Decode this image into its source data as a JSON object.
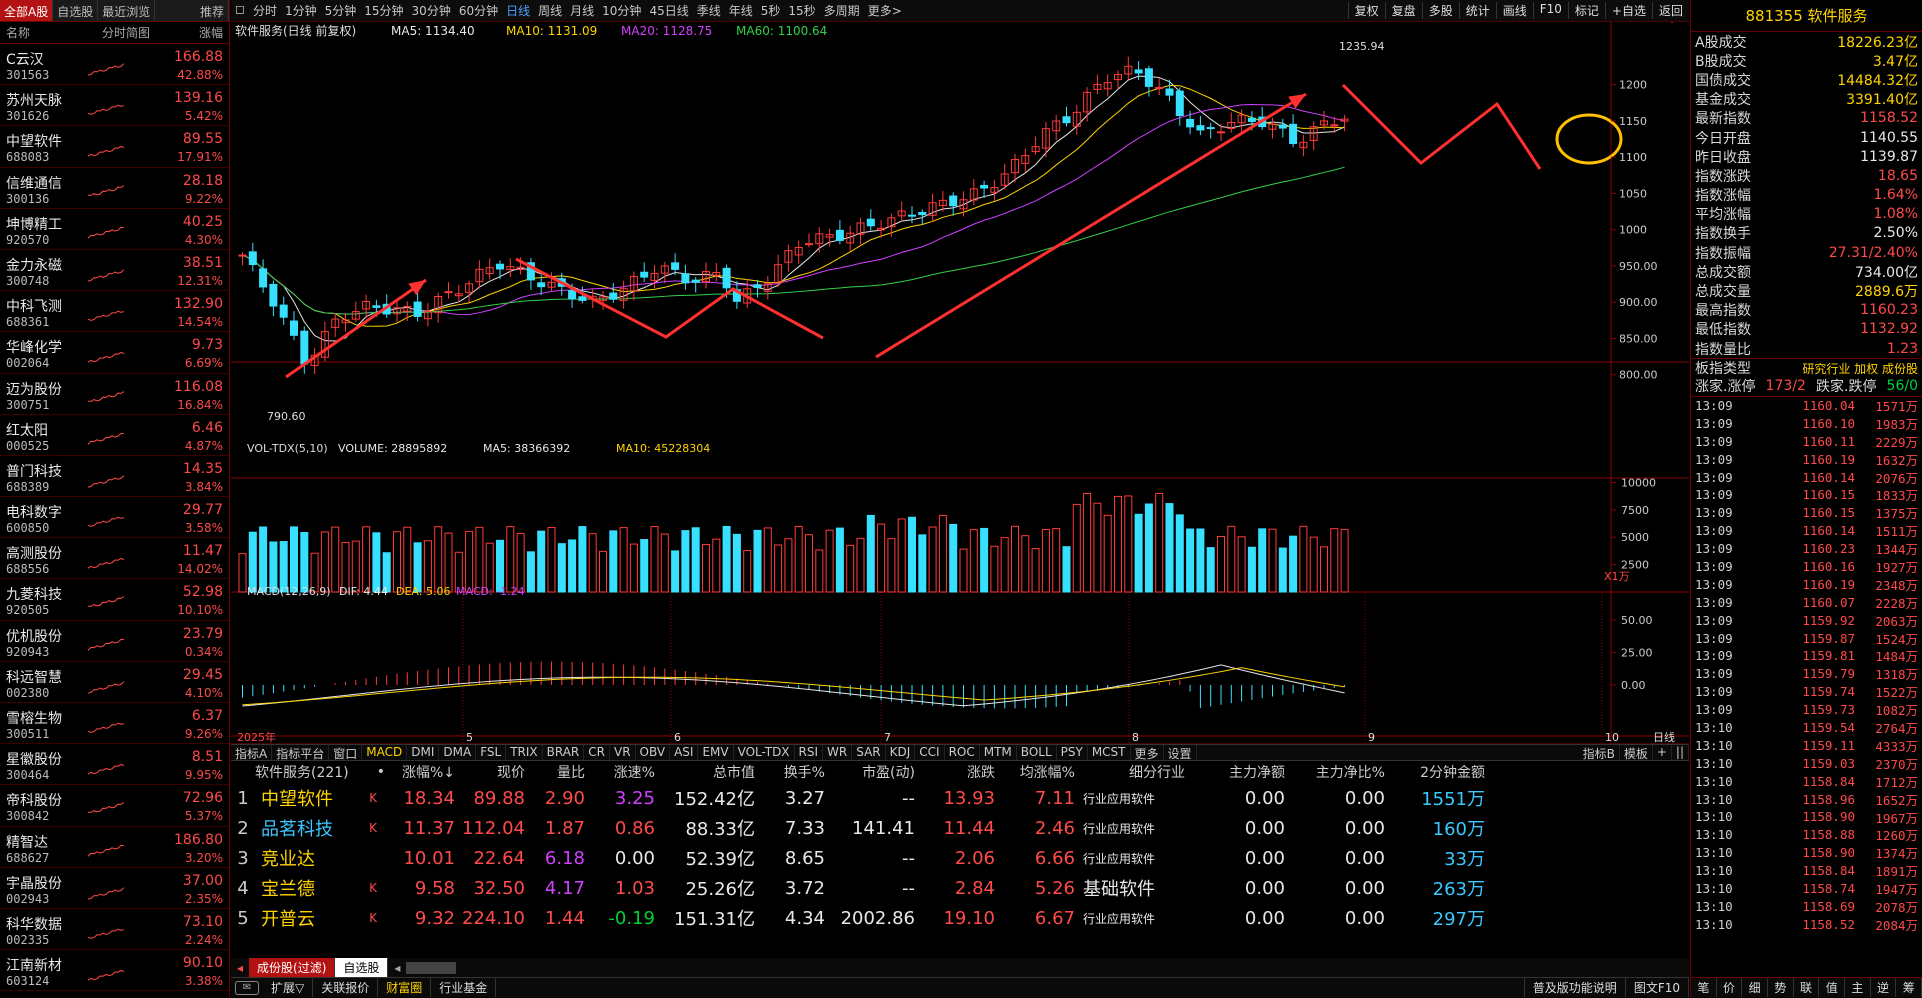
{
  "left_panel": {
    "tabs": [
      "全部A股",
      "自选股",
      "最近浏览",
      "推荐"
    ],
    "header": {
      "name": "名称",
      "chart": "分时简图",
      "change": "涨幅"
    },
    "stocks": [
      {
        "name": "C云汉",
        "code": "301563",
        "price": "166.88",
        "pct": "42.88%"
      },
      {
        "name": "苏州天脉",
        "code": "301626",
        "price": "139.16",
        "pct": "5.42%"
      },
      {
        "name": "中望软件",
        "code": "688083",
        "price": "89.55",
        "pct": "17.91%"
      },
      {
        "name": "信维通信",
        "code": "300136",
        "price": "28.18",
        "pct": "9.22%"
      },
      {
        "name": "坤博精工",
        "code": "920570",
        "price": "40.25",
        "pct": "4.30%"
      },
      {
        "name": "金力永磁",
        "code": "300748",
        "price": "38.51",
        "pct": "12.31%"
      },
      {
        "name": "中科飞测",
        "code": "688361",
        "price": "132.90",
        "pct": "14.54%"
      },
      {
        "name": "华峰化学",
        "code": "002064",
        "price": "9.73",
        "pct": "6.69%"
      },
      {
        "name": "迈为股份",
        "code": "300751",
        "price": "116.08",
        "pct": "16.84%"
      },
      {
        "name": "红太阳",
        "code": "000525",
        "price": "6.46",
        "pct": "4.87%"
      },
      {
        "name": "普门科技",
        "code": "688389",
        "price": "14.35",
        "pct": "3.84%"
      },
      {
        "name": "电科数字",
        "code": "600850",
        "price": "29.77",
        "pct": "3.58%"
      },
      {
        "name": "高测股份",
        "code": "688556",
        "price": "11.47",
        "pct": "14.02%"
      },
      {
        "name": "九菱科技",
        "code": "920505",
        "price": "52.98",
        "pct": "10.10%"
      },
      {
        "name": "优机股份",
        "code": "920943",
        "price": "23.79",
        "pct": "0.34%"
      },
      {
        "name": "科远智慧",
        "code": "002380",
        "price": "29.45",
        "pct": "4.10%"
      },
      {
        "name": "雪榕生物",
        "code": "300511",
        "price": "6.37",
        "pct": "9.26%"
      },
      {
        "name": "星徽股份",
        "code": "300464",
        "price": "8.51",
        "pct": "9.95%"
      },
      {
        "name": "帝科股份",
        "code": "300842",
        "price": "72.96",
        "pct": "5.37%"
      },
      {
        "name": "精智达",
        "code": "688627",
        "price": "186.80",
        "pct": "3.20%"
      },
      {
        "name": "宇晶股份",
        "code": "002943",
        "price": "37.00",
        "pct": "2.35%"
      },
      {
        "name": "科华数据",
        "code": "002335",
        "price": "73.10",
        "pct": "2.24%"
      },
      {
        "name": "江南新材",
        "code": "603124",
        "price": "90.10",
        "pct": "3.38%"
      }
    ]
  },
  "toolbar": {
    "periods": [
      "分时",
      "1分钟",
      "5分钟",
      "15分钟",
      "30分钟",
      "60分钟",
      "日线",
      "周线",
      "月线",
      "10分钟",
      "45日线",
      "季线",
      "年线",
      "5秒",
      "15秒",
      "多周期",
      "更多>"
    ],
    "active": "日线",
    "right": [
      "复权",
      "复盘",
      "多股",
      "统计",
      "画线",
      "F10",
      "标记",
      "+自选",
      "返回"
    ]
  },
  "chart_header": {
    "title": "软件服务(日线 前复权)",
    "ma5": "MA5: 1134.40",
    "ma10": "MA10: 1131.09",
    "ma20": "MA20: 1128.75",
    "ma60": "MA60: 1100.64",
    "high_label": "1235.94",
    "low_label": "790.60"
  },
  "vol_header": {
    "name": "VOL-TDX(5,10)",
    "volume": "VOLUME: 28895892",
    "ma5": "MA5: 38366392",
    "ma10": "MA10: 45228304",
    "unit": "X1万"
  },
  "macd_header": {
    "name": "MACD(12,26,9)",
    "dif": "DIF: 4.44",
    "dea": "DEA: 5.06",
    "macd": "MACD: -1.24"
  },
  "price_axis": [
    "1200",
    "1150",
    "1100",
    "1050",
    "1000",
    "950.00",
    "900.00",
    "850.00",
    "800.00"
  ],
  "vol_axis": [
    "10000",
    "7500",
    "5000",
    "2500"
  ],
  "macd_axis": [
    "50.00",
    "25.00",
    "0.00"
  ],
  "date_axis": {
    "year": "2025年",
    "months": [
      "5",
      "6",
      "7",
      "8",
      "9",
      "10"
    ],
    "period": "日线"
  },
  "indicator_tabs": [
    "指标A",
    "指标平台",
    "窗口",
    "MACD",
    "DMI",
    "DMA",
    "FSL",
    "TRIX",
    "BRAR",
    "CR",
    "VR",
    "OBV",
    "ASI",
    "EMV",
    "VOL-TDX",
    "RSI",
    "WR",
    "SAR",
    "KDJ",
    "CCI",
    "ROC",
    "MTM",
    "BOLL",
    "PSY",
    "MCST",
    "更多",
    "设置"
  ],
  "indicator_right": [
    "指标B",
    "模板",
    "+",
    "||"
  ],
  "table": {
    "headers": [
      "软件服务(221)",
      "•",
      "涨幅%↓",
      "现价",
      "量比",
      "涨速%",
      "总市值",
      "换手%",
      "市盈(动)",
      "涨跌",
      "均涨幅%",
      "细分行业",
      "主力净额",
      "主力净比%",
      "2分钟金额"
    ],
    "rows": [
      {
        "idx": "1",
        "name": "中望软件",
        "flag": "K",
        "pct": "18.34",
        "price": "89.88",
        "vr": "2.90",
        "speed": "3.25",
        "cap": "152.42亿",
        "turn": "3.27",
        "pe": "--",
        "chg": "13.93",
        "avg": "7.11",
        "ind": "行业应用软件",
        "net": "0.00",
        "ratio": "0.00",
        "amt": "1551万"
      },
      {
        "idx": "2",
        "name": "品茗科技",
        "flag": "K",
        "pct": "11.37",
        "price": "112.04",
        "vr": "1.87",
        "speed": "0.86",
        "cap": "88.33亿",
        "turn": "7.33",
        "pe": "141.41",
        "chg": "11.44",
        "avg": "2.46",
        "ind": "行业应用软件",
        "net": "0.00",
        "ratio": "0.00",
        "amt": "160万"
      },
      {
        "idx": "3",
        "name": "竞业达",
        "flag": "",
        "pct": "10.01",
        "price": "22.64",
        "vr": "6.18",
        "speed": "0.00",
        "cap": "52.39亿",
        "turn": "8.65",
        "pe": "--",
        "chg": "2.06",
        "avg": "6.66",
        "ind": "行业应用软件",
        "net": "0.00",
        "ratio": "0.00",
        "amt": "33万"
      },
      {
        "idx": "4",
        "name": "宝兰德",
        "flag": "K",
        "pct": "9.58",
        "price": "32.50",
        "vr": "4.17",
        "speed": "1.03",
        "cap": "25.26亿",
        "turn": "3.72",
        "pe": "--",
        "chg": "2.84",
        "avg": "5.26",
        "ind": "基础软件",
        "net": "0.00",
        "ratio": "0.00",
        "amt": "263万"
      },
      {
        "idx": "5",
        "name": "开普云",
        "flag": "K",
        "pct": "9.32",
        "price": "224.10",
        "vr": "1.44",
        "speed": "-0.19",
        "cap": "151.31亿",
        "turn": "4.34",
        "pe": "2002.86",
        "chg": "19.10",
        "avg": "6.67",
        "ind": "行业应用软件",
        "net": "0.00",
        "ratio": "0.00",
        "amt": "297万"
      }
    ]
  },
  "bottom_tabs1": [
    "成份股(过滤)",
    "自选股"
  ],
  "bottom_tabs2": [
    "扩展▽",
    "关联报价",
    "财富圈",
    "行业基金"
  ],
  "bottom_right": [
    "普及版功能说明",
    "图文F10"
  ],
  "right_panel": {
    "title": "881355 软件服务",
    "rows": [
      {
        "k": "A股成交",
        "v": "18226.23亿"
      },
      {
        "k": "B股成交",
        "v": "3.47亿"
      },
      {
        "k": "国债成交",
        "v": "14484.32亿"
      },
      {
        "k": "基金成交",
        "v": "3391.40亿"
      },
      {
        "k": "最新指数",
        "v": "1158.52"
      },
      {
        "k": "今日开盘",
        "v": "1140.55"
      },
      {
        "k": "昨日收盘",
        "v": "1139.87"
      },
      {
        "k": "指数涨跌",
        "v": "18.65"
      },
      {
        "k": "指数涨幅",
        "v": "1.64%"
      },
      {
        "k": "平均涨幅",
        "v": "1.08%"
      },
      {
        "k": "指数换手",
        "v": "2.50%"
      },
      {
        "k": "指数振幅",
        "v": "27.31/2.40%"
      },
      {
        "k": "总成交额",
        "v": "734.00亿"
      },
      {
        "k": "总成交量",
        "v": "2889.6万"
      },
      {
        "k": "最高指数",
        "v": "1160.23"
      },
      {
        "k": "最低指数",
        "v": "1132.92"
      },
      {
        "k": "指数量比",
        "v": "1.23"
      }
    ],
    "plate_label": "板指类型",
    "plate_value": "研究行业 加权 成份股",
    "updown_label": "涨家.涨停",
    "updown_value": "173/2",
    "downs_label": "跌家.跌停",
    "downs_value": "56/0",
    "ticks": [
      {
        "t": "13:09",
        "p": "1160.04",
        "v": "1571万"
      },
      {
        "t": "13:09",
        "p": "1160.10",
        "v": "1983万"
      },
      {
        "t": "13:09",
        "p": "1160.11",
        "v": "2229万"
      },
      {
        "t": "13:09",
        "p": "1160.19",
        "v": "1632万"
      },
      {
        "t": "13:09",
        "p": "1160.14",
        "v": "2076万"
      },
      {
        "t": "13:09",
        "p": "1160.15",
        "v": "1833万"
      },
      {
        "t": "13:09",
        "p": "1160.15",
        "v": "1375万"
      },
      {
        "t": "13:09",
        "p": "1160.14",
        "v": "1511万"
      },
      {
        "t": "13:09",
        "p": "1160.23",
        "v": "1344万"
      },
      {
        "t": "13:09",
        "p": "1160.16",
        "v": "1927万"
      },
      {
        "t": "13:09",
        "p": "1160.19",
        "v": "2348万"
      },
      {
        "t": "13:09",
        "p": "1160.07",
        "v": "2228万"
      },
      {
        "t": "13:09",
        "p": "1159.92",
        "v": "2063万"
      },
      {
        "t": "13:09",
        "p": "1159.87",
        "v": "1524万"
      },
      {
        "t": "13:09",
        "p": "1159.81",
        "v": "1484万"
      },
      {
        "t": "13:09",
        "p": "1159.79",
        "v": "1318万"
      },
      {
        "t": "13:09",
        "p": "1159.74",
        "v": "1522万"
      },
      {
        "t": "13:09",
        "p": "1159.73",
        "v": "1082万"
      },
      {
        "t": "13:10",
        "p": "1159.54",
        "v": "2764万"
      },
      {
        "t": "13:10",
        "p": "1159.11",
        "v": "4333万"
      },
      {
        "t": "13:10",
        "p": "1159.03",
        "v": "2370万"
      },
      {
        "t": "13:10",
        "p": "1158.84",
        "v": "1712万"
      },
      {
        "t": "13:10",
        "p": "1158.96",
        "v": "1652万"
      },
      {
        "t": "13:10",
        "p": "1158.90",
        "v": "1967万"
      },
      {
        "t": "13:10",
        "p": "1158.88",
        "v": "1260万"
      },
      {
        "t": "13:10",
        "p": "1158.90",
        "v": "1374万"
      },
      {
        "t": "13:10",
        "p": "1158.84",
        "v": "1891万"
      },
      {
        "t": "13:10",
        "p": "1158.74",
        "v": "1947万"
      },
      {
        "t": "13:10",
        "p": "1158.69",
        "v": "2078万"
      },
      {
        "t": "13:10",
        "p": "1158.52",
        "v": "2084万"
      }
    ],
    "bottom_tabs": [
      "笔",
      "价",
      "细",
      "势",
      "联",
      "值",
      "主",
      "逆",
      "筹"
    ]
  }
}
